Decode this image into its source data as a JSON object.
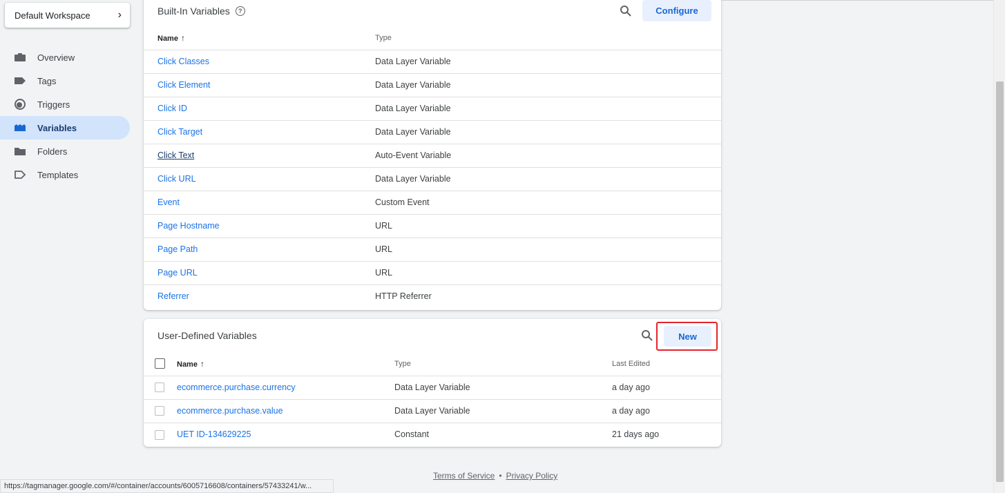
{
  "sidebar": {
    "workspace_label": "Default Workspace",
    "items": [
      {
        "label": "Overview",
        "icon": "briefcase-icon"
      },
      {
        "label": "Tags",
        "icon": "tag-icon"
      },
      {
        "label": "Triggers",
        "icon": "trigger-icon"
      },
      {
        "label": "Variables",
        "icon": "variables-icon",
        "active": true
      },
      {
        "label": "Folders",
        "icon": "folder-icon"
      },
      {
        "label": "Templates",
        "icon": "template-icon"
      }
    ]
  },
  "builtin": {
    "title": "Built-In Variables",
    "configure_label": "Configure",
    "col_name": "Name",
    "col_type": "Type",
    "rows": [
      {
        "name": "Click Classes",
        "type": "Data Layer Variable"
      },
      {
        "name": "Click Element",
        "type": "Data Layer Variable"
      },
      {
        "name": "Click ID",
        "type": "Data Layer Variable"
      },
      {
        "name": "Click Target",
        "type": "Data Layer Variable"
      },
      {
        "name": "Click Text",
        "type": "Auto-Event Variable"
      },
      {
        "name": "Click URL",
        "type": "Data Layer Variable"
      },
      {
        "name": "Event",
        "type": "Custom Event"
      },
      {
        "name": "Page Hostname",
        "type": "URL"
      },
      {
        "name": "Page Path",
        "type": "URL"
      },
      {
        "name": "Page URL",
        "type": "URL"
      },
      {
        "name": "Referrer",
        "type": "HTTP Referrer"
      }
    ]
  },
  "userdef": {
    "title": "User-Defined Variables",
    "new_label": "New",
    "col_name": "Name",
    "col_type": "Type",
    "col_edited": "Last Edited",
    "rows": [
      {
        "name": "ecommerce.purchase.currency",
        "type": "Data Layer Variable",
        "edited": "a day ago"
      },
      {
        "name": "ecommerce.purchase.value",
        "type": "Data Layer Variable",
        "edited": "a day ago"
      },
      {
        "name": "UET ID-134629225",
        "type": "Constant",
        "edited": "21 days ago"
      }
    ]
  },
  "footer": {
    "terms": "Terms of Service",
    "separator": "•",
    "privacy": "Privacy Policy"
  },
  "status_url": "https://tagmanager.google.com/#/container/accounts/6005716608/containers/57433241/w...",
  "colors": {
    "accent": "#1a73e8",
    "highlight": "#e3242b",
    "active_bg": "#d2e3fc"
  }
}
